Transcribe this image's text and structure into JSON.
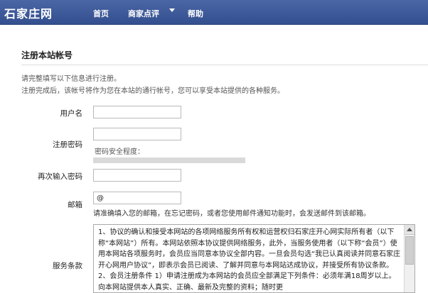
{
  "header": {
    "logo": "石家庄网",
    "nav": {
      "home": "首页",
      "merchant_reviews": "商家点评",
      "help": "帮助"
    }
  },
  "form": {
    "title": "注册本站帐号",
    "intro_line1": "请完整填写以下信息进行注册。",
    "intro_line2": "注册完成后，该帐号将作为您在本站的通行帐号，您可以享受本站提供的各种服务。",
    "username": {
      "label": "用户名",
      "value": ""
    },
    "password": {
      "label": "注册密码",
      "value": "",
      "strength_label": "密码安全程度："
    },
    "confirm_password": {
      "label": "再次输入密码",
      "value": ""
    },
    "email": {
      "label": "邮箱",
      "value": "@",
      "hint": "请准确填入您的邮箱，在忘记密码，或者您使用邮件通知功能时，会发送邮件到该邮箱。"
    },
    "terms": {
      "label": "服务条款",
      "text": "1、协议的确认和接受本网站的各项网络服务所有权和运营权归石家庄开心网实际所有者（以下称“本网站”）所有。本网站依照本协议提供网络服务，此外，当服务使用者（以下称“会员”）使用本网站各项服务时，会员应当同意本协议全部内容。一旦会员勾选“我已认真阅读并同意石家庄开心网用户协议”，即表示会员已阅读、了解并同意与本网站达成协议，并接受所有协议条款。 2、会员注册条件 1）申请注册成为本网站的会员应全部满足下列条件：必须年满18周岁以上。向本网站提供本人真实、正确、最新及完整的资料；随时更"
    }
  }
}
